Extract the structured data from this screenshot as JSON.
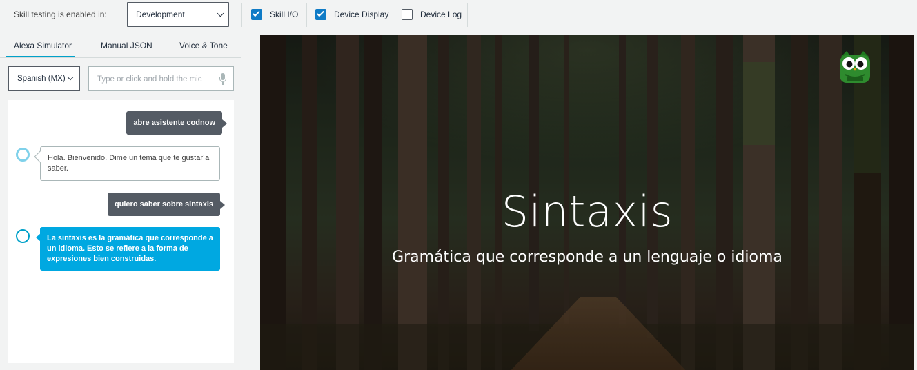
{
  "topbar": {
    "label": "Skill testing is enabled in:",
    "stage_select": "Development",
    "checkboxes": [
      {
        "label": "Skill I/O",
        "checked": true
      },
      {
        "label": "Device Display",
        "checked": true
      },
      {
        "label": "Device Log",
        "checked": false
      }
    ]
  },
  "tabs": [
    {
      "label": "Alexa Simulator",
      "active": true
    },
    {
      "label": "Manual JSON",
      "active": false
    },
    {
      "label": "Voice & Tone",
      "active": false
    }
  ],
  "simulator": {
    "language": "Spanish (MX)",
    "utterance_placeholder": "Type or click and hold the mic",
    "utterance_value": ""
  },
  "conversation": [
    {
      "speaker": "user",
      "text": "abre asistente codnow"
    },
    {
      "speaker": "alexa",
      "text": "Hola. Bienvenido. Dime un tema que te gustaría saber.",
      "highlighted": false
    },
    {
      "speaker": "user",
      "text": "quiero saber sobre sintaxis"
    },
    {
      "speaker": "alexa",
      "text": "La sintaxis es la gramática que corresponde a un idioma. Esto se refiere a la forma de expresiones bien construidas.",
      "highlighted": true
    }
  ],
  "display": {
    "title": "Sintaxis",
    "subtitle": "Gramática que corresponde a un lenguaje o idioma",
    "logo_icon": "owl-icon",
    "background": "forest-path"
  },
  "colors": {
    "accent": "#00a1c9",
    "checkbox": "#0f7bc6",
    "user_bubble": "#545b64",
    "alexa_highlight": "#00a8e1"
  }
}
